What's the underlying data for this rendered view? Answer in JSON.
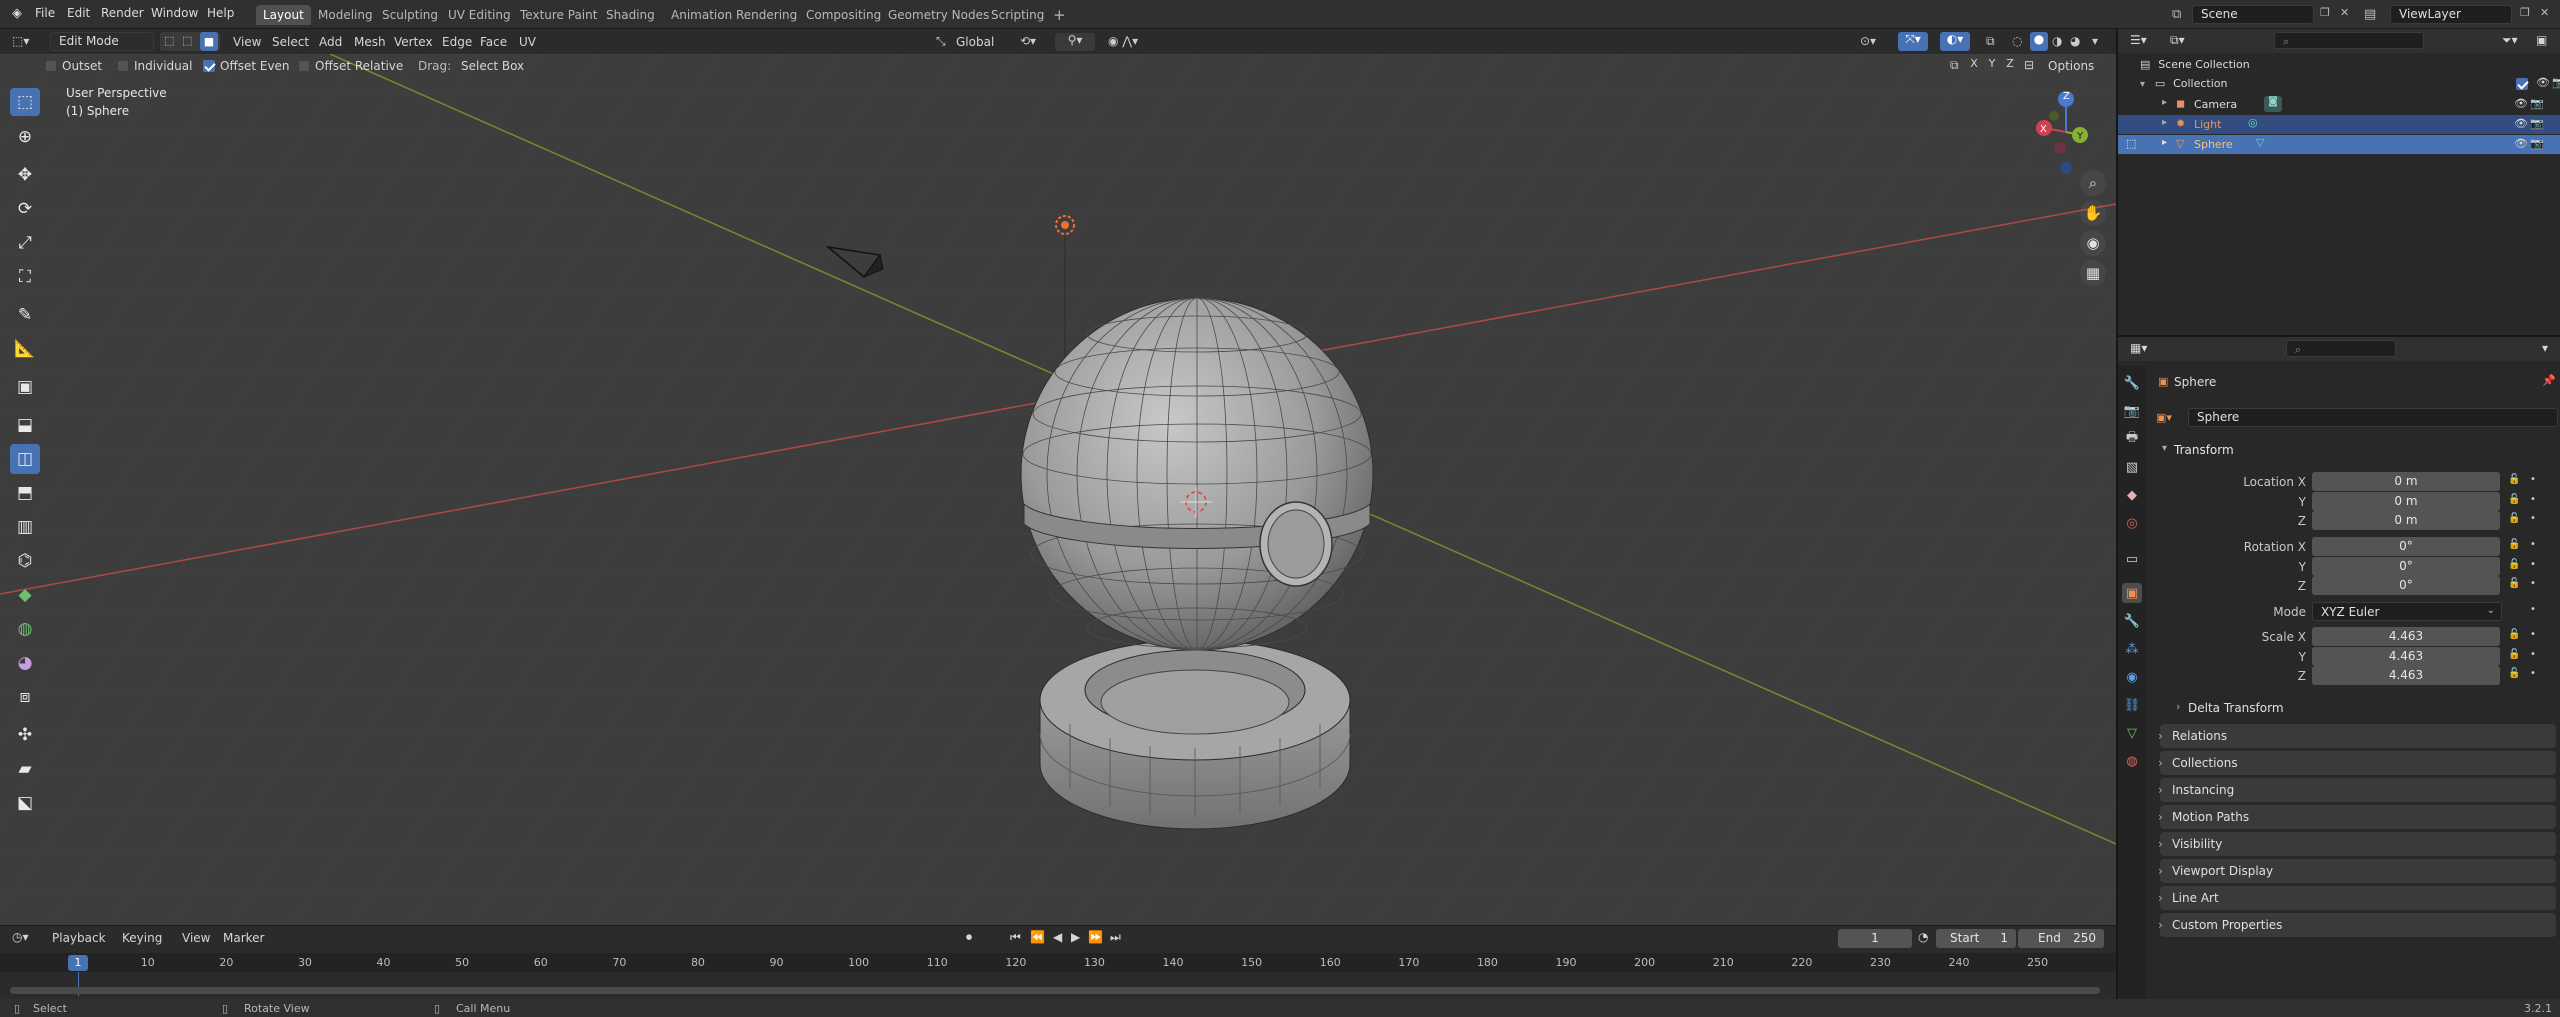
{
  "topbar": {
    "menus": [
      "File",
      "Edit",
      "Render",
      "Window",
      "Help"
    ],
    "workspaces": [
      "Layout",
      "Modeling",
      "Sculpting",
      "UV Editing",
      "Texture Paint",
      "Shading",
      "Animation",
      "Rendering",
      "Compositing",
      "Geometry Nodes",
      "Scripting"
    ],
    "active_workspace": "Layout",
    "add_tab_icon": "plus",
    "scene": "Scene",
    "view_layer": "ViewLayer"
  },
  "viewport_header": {
    "mode": "Edit Mode",
    "menus": [
      "View",
      "Select",
      "Add",
      "Mesh",
      "Vertex",
      "Edge",
      "Face",
      "UV"
    ],
    "orientation": "Global",
    "axis_x": "X",
    "axis_y": "Y",
    "axis_z": "Z",
    "options_label": "Options"
  },
  "tool_settings": {
    "outset": {
      "label": "Outset",
      "checked": false
    },
    "individual": {
      "label": "Individual",
      "checked": false
    },
    "offset_even": {
      "label": "Offset Even",
      "checked": true
    },
    "offset_relative": {
      "label": "Offset Relative",
      "checked": false
    },
    "drag_label": "Drag:",
    "drag_value": "Select Box"
  },
  "viewport": {
    "perspective_label": "User Perspective",
    "object_label": "(1) Sphere",
    "gizmo": {
      "x": "X",
      "y": "Y",
      "z": "Z"
    },
    "colors": {
      "background": "#3d3d3d",
      "x_axis": "#c04040",
      "y_axis": "#80a030",
      "active_tool": "#4772b3"
    }
  },
  "timeline": {
    "menus": [
      "Playback",
      "Keying",
      "View",
      "Marker"
    ],
    "current_frame": "1",
    "start_label": "Start",
    "start_value": "1",
    "end_label": "End",
    "end_value": "250",
    "ticks": [
      "10",
      "20",
      "30",
      "40",
      "50",
      "60",
      "70",
      "80",
      "90",
      "100",
      "110",
      "120",
      "130",
      "140",
      "150",
      "160",
      "170",
      "180",
      "190",
      "200",
      "210",
      "220",
      "230",
      "240",
      "250"
    ],
    "playhead": "1"
  },
  "statusbar": {
    "items": [
      "Select",
      "Rotate View",
      "Call Menu"
    ],
    "version": "3.2.1"
  },
  "outliner": {
    "root": "Scene Collection",
    "collection": "Collection",
    "items": [
      {
        "name": "Camera",
        "icon": "camera-icon"
      },
      {
        "name": "Light",
        "icon": "light-icon"
      },
      {
        "name": "Sphere",
        "icon": "mesh-icon"
      }
    ]
  },
  "properties": {
    "object_name_header": "Sphere",
    "object_name_field": "Sphere",
    "transform_label": "Transform",
    "location_labels": [
      "Location X",
      "Y",
      "Z"
    ],
    "location_values": [
      "0 m",
      "0 m",
      "0 m"
    ],
    "rotation_labels": [
      "Rotation X",
      "Y",
      "Z"
    ],
    "rotation_values": [
      "0°",
      "0°",
      "0°"
    ],
    "mode_label": "Mode",
    "mode_value": "XYZ Euler",
    "scale_labels": [
      "Scale X",
      "Y",
      "Z"
    ],
    "scale_values": [
      "4.463",
      "4.463",
      "4.463"
    ],
    "delta_transform": "Delta Transform",
    "panels": [
      "Relations",
      "Collections",
      "Instancing",
      "Motion Paths",
      "Visibility",
      "Viewport Display",
      "Line Art",
      "Custom Properties"
    ]
  }
}
